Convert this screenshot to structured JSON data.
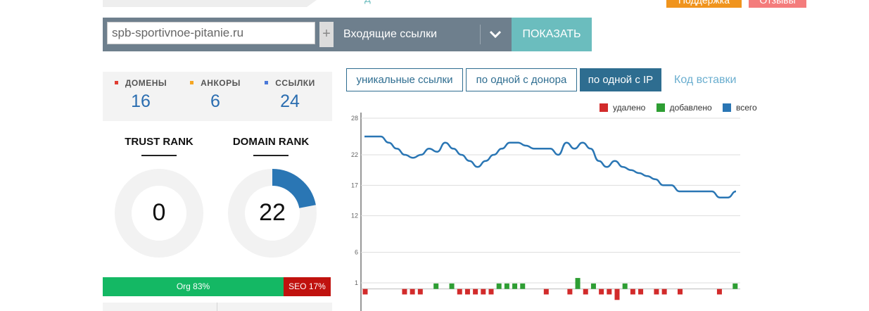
{
  "header": {
    "top_link": "Д",
    "support_button": "Поддержка",
    "feedback_button": "Отзывы"
  },
  "search": {
    "domain_value": "spb-sportivnoe-pitanie.ru",
    "add_label": "+",
    "type_selected": "Входящие ссылки",
    "show_button": "ПОКАЗАТЬ"
  },
  "stats": [
    {
      "label": "ДОМЕНЫ",
      "value": "16",
      "color": "#e03c31"
    },
    {
      "label": "АНКОРЫ",
      "value": "6",
      "color": "#f5a623"
    },
    {
      "label": "ССЫЛКИ",
      "value": "24",
      "color": "#4a78d8"
    }
  ],
  "ranks": {
    "trust_rank": {
      "title": "TRUST RANK",
      "value": "0",
      "fraction": 0
    },
    "domain_rank": {
      "title": "DOMAIN RANK",
      "value": "22",
      "fraction": 0.22
    }
  },
  "traffic_split": {
    "org_label": "Org 83%",
    "org_percent": 83,
    "seo_label": "SEO 17%",
    "seo_percent": 17,
    "org_color": "#14b864",
    "seo_color": "#c0120e"
  },
  "filters": {
    "tabs": [
      "уникальные ссылки",
      "по одной с донора",
      "по одной с IP"
    ],
    "active_index": 2,
    "embed_link": "Код вставки"
  },
  "chart_data": {
    "type": "line",
    "legend": [
      {
        "name": "удалено",
        "color": "#d22b2b"
      },
      {
        "name": "добавлено",
        "color": "#2e9e33"
      },
      {
        "name": "всего",
        "color": "#2a76b4"
      }
    ],
    "legend_position": "top-right",
    "y_ticks": [
      28,
      22,
      17,
      12,
      6,
      1
    ],
    "ylim": [
      -1.5,
      28
    ],
    "grid": true,
    "series": [
      {
        "name": "всего",
        "values": [
          25,
          25,
          25,
          24,
          23,
          22,
          21.5,
          22,
          23,
          22.5,
          24,
          23,
          22,
          21,
          20,
          21,
          22,
          23,
          24,
          24,
          23.5,
          23,
          23,
          23,
          22,
          24,
          23,
          24,
          23,
          21,
          20,
          21,
          20,
          19.5,
          19,
          18.5,
          18,
          17,
          17,
          16,
          16,
          16,
          16,
          16,
          15,
          15,
          16
        ]
      }
    ],
    "changes": [
      -1,
      0,
      0,
      0,
      0,
      -1,
      -1,
      -1,
      0,
      1,
      0,
      1,
      -1,
      -1,
      -1,
      -1,
      -1,
      1,
      1,
      1,
      1,
      0,
      0,
      -1,
      0,
      0,
      -1,
      2,
      -1,
      1,
      -1,
      -1,
      -2,
      1,
      -1,
      -1,
      0,
      -1,
      -1,
      0,
      -1,
      0,
      0,
      0,
      0,
      -1,
      0,
      1
    ]
  }
}
